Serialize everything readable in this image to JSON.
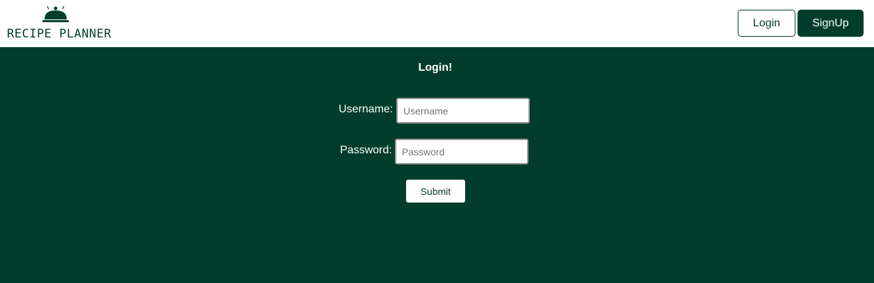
{
  "brand": {
    "name": "RECIPE PLANNER",
    "icon": "cloche-icon",
    "color": "#003d2b"
  },
  "nav": {
    "login_label": "Login",
    "signup_label": "SignUp"
  },
  "form": {
    "title": "Login!",
    "username_label": "Username:",
    "username_placeholder": "Username",
    "username_value": "",
    "password_label": "Password:",
    "password_placeholder": "Password",
    "password_value": "",
    "submit_label": "Submit"
  },
  "colors": {
    "primary": "#003d2b",
    "background": "#ffffff"
  }
}
